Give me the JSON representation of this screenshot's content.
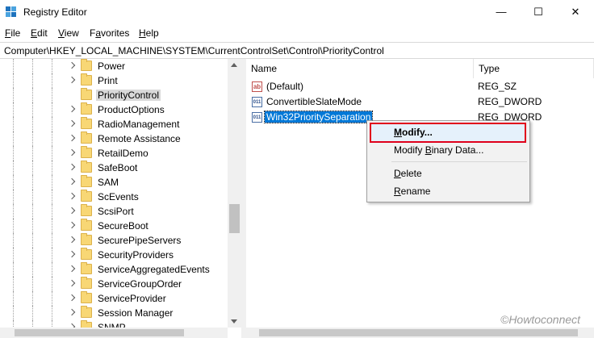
{
  "window": {
    "title": "Registry Editor",
    "minimize": "—",
    "maximize": "☐",
    "close": "✕"
  },
  "menubar": {
    "file": {
      "mnemonic": "F",
      "rest": "ile"
    },
    "edit": {
      "mnemonic": "E",
      "rest": "dit"
    },
    "view": {
      "mnemonic": "V",
      "rest": "iew"
    },
    "favorites": {
      "pre": "F",
      "mnemonic": "a",
      "rest": "vorites"
    },
    "help": {
      "mnemonic": "H",
      "rest": "elp"
    }
  },
  "address": "Computer\\HKEY_LOCAL_MACHINE\\SYSTEM\\CurrentControlSet\\Control\\PriorityControl",
  "tree": {
    "items": [
      {
        "label": "Power"
      },
      {
        "label": "Print"
      },
      {
        "label": "PriorityControl",
        "selected": true
      },
      {
        "label": "ProductOptions"
      },
      {
        "label": "RadioManagement"
      },
      {
        "label": "Remote Assistance"
      },
      {
        "label": "RetailDemo"
      },
      {
        "label": "SafeBoot"
      },
      {
        "label": "SAM"
      },
      {
        "label": "ScEvents"
      },
      {
        "label": "ScsiPort"
      },
      {
        "label": "SecureBoot"
      },
      {
        "label": "SecurePipeServers"
      },
      {
        "label": "SecurityProviders"
      },
      {
        "label": "ServiceAggregatedEvents"
      },
      {
        "label": "ServiceGroupOrder"
      },
      {
        "label": "ServiceProvider"
      },
      {
        "label": "Session Manager"
      },
      {
        "label": "SNMP"
      }
    ]
  },
  "list": {
    "columns": {
      "name": "Name",
      "type": "Type"
    },
    "rows": [
      {
        "name": "(Default)",
        "type": "REG_SZ",
        "icon": "string-value-icon",
        "icon_text": "ab"
      },
      {
        "name": "ConvertibleSlateMode",
        "type": "REG_DWORD",
        "icon": "binary-value-icon",
        "icon_text": "011"
      },
      {
        "name": "Win32PrioritySeparation",
        "type": "REG_DWORD",
        "icon": "binary-value-icon",
        "icon_text": "011",
        "selected": true
      }
    ]
  },
  "context_menu": {
    "modify": {
      "mnemonic": "M",
      "rest": "odify..."
    },
    "modify_binary": {
      "pre": "Modify ",
      "mnemonic": "B",
      "rest": "inary Data..."
    },
    "delete": {
      "mnemonic": "D",
      "rest": "elete"
    },
    "rename": {
      "mnemonic": "R",
      "rest": "ename"
    }
  },
  "watermark": "©Howtoconnect",
  "colors": {
    "selection": "#0078d7",
    "highlight_box": "#e0001b",
    "folder": "#f8d775"
  }
}
